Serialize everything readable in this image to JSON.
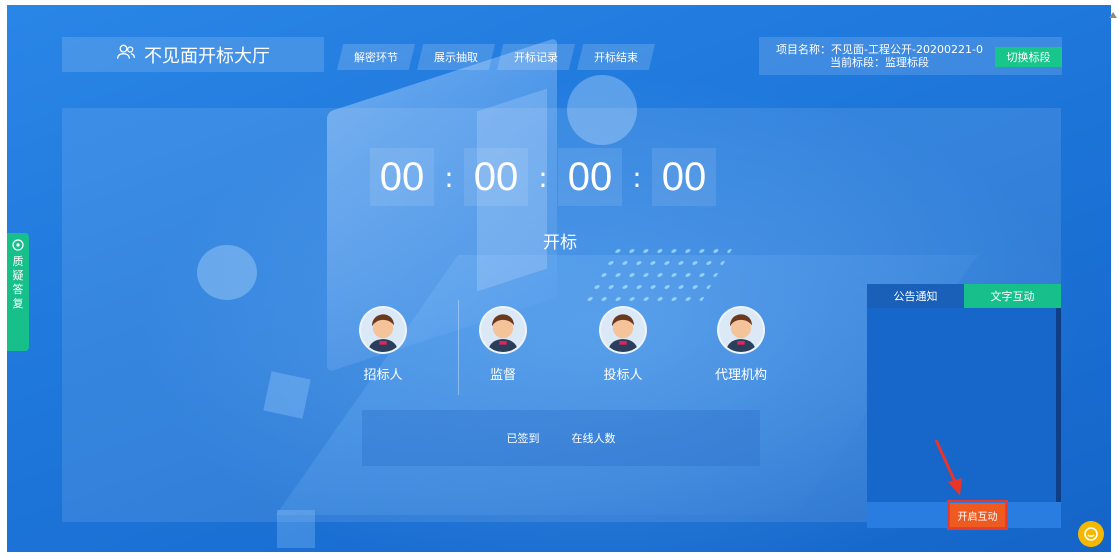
{
  "header": {
    "title": "不见面开标大厅",
    "tabs": [
      "解密环节",
      "展示抽取",
      "开标记录",
      "开标结束"
    ],
    "project_line1": "项目名称：不见面-工程公开-20200221-0",
    "project_line2": "当前标段：监理标段",
    "switch_label": "切换标段"
  },
  "countdown": {
    "days": "00",
    "hours": "00",
    "minutes": "00",
    "seconds": "00",
    "separator": ":"
  },
  "status_label": "开标",
  "roles": [
    {
      "label": "招标人"
    },
    {
      "label": "监督"
    },
    {
      "label": "投标人"
    },
    {
      "label": "代理机构"
    }
  ],
  "stats": {
    "signed_label": "已签到",
    "online_label": "在线人数"
  },
  "chat": {
    "tab_notice": "公告通知",
    "tab_text": "文字互动",
    "open_button": "开启互动"
  },
  "side_tab": {
    "chars": [
      "质",
      "疑",
      "答",
      "复"
    ]
  },
  "colors": {
    "accent_green": "#17c08a",
    "button_orange": "#ee5a1f",
    "float_yellow": "#f5b800"
  }
}
